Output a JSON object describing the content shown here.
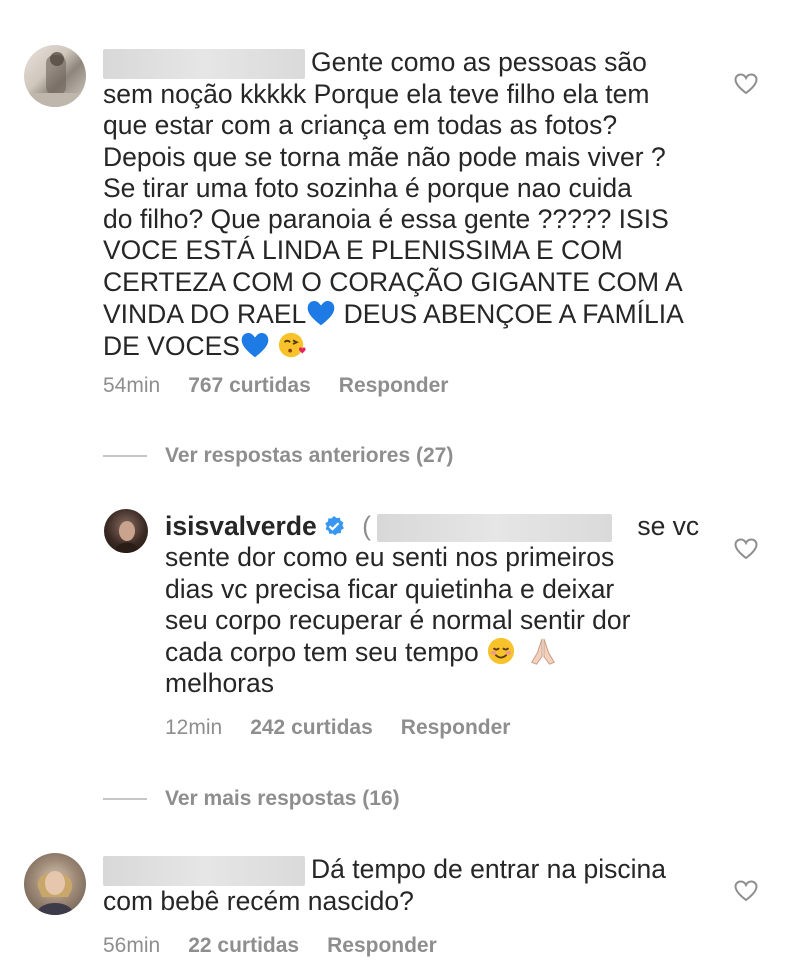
{
  "comments": [
    {
      "text": "Gente como as pessoas são sem noção kkkkk Porque ela teve filho ela tem que estar com a criança em todas as fotos? Depois que se torna mãe não pode mais viver ? Se tirar uma foto sozinha é porque nao cuida do filho? Que paranoia é essa gente ????? ISIS VOCE ESTÁ LINDA E PLENISSIMA E COM CERTEZA COM O CORAÇÃO GIGANTE COM A VINDA DO RAEL",
      "text_line1": "Gente como as pessoas são",
      "lines": [
        "sem noção kkkkk Porque ela teve filho ela tem",
        "que estar com a criança em todas as fotos?",
        "Depois que se torna mãe não pode mais viver ?",
        "Se tirar uma foto sozinha é porque nao cuida",
        "do filho? Que paranoia é essa gente ????? ISIS",
        "VOCE ESTÁ LINDA E PLENISSIMA E COM",
        "CERTEZA COM O CORAÇÃO GIGANTE COM A"
      ],
      "line_rael": "VINDA DO RAEL",
      "line_rael_after": " DEUS ABENÇOE A FAMÍLIA",
      "line_last": "DE VOCES",
      "time": "54min",
      "likes": "767 curtidas",
      "reply": "Responder"
    },
    {
      "username": "isisvalverde",
      "after_mention": " se vc",
      "lines": [
        "sente dor como eu senti nos primeiros",
        "dias vc precisa ficar quietinha e deixar",
        "seu corpo recuperar é normal sentir dor"
      ],
      "line_emoji": "cada corpo tem seu tempo ",
      "line_last": "melhoras",
      "time": "12min",
      "likes": "242 curtidas",
      "reply": "Responder"
    },
    {
      "text_line1": "Dá tempo de entrar na piscina",
      "line2": "com bebê recém nascido?",
      "time": "56min",
      "likes": "22 curtidas",
      "reply": "Responder"
    }
  ],
  "threads": {
    "previous": "Ver respostas anteriores (27)",
    "more": "Ver mais respostas (16)"
  },
  "colors": {
    "text": "#262626",
    "meta": "#8e8e8e",
    "verified": "#3897f0",
    "heart_blue": "#1e7be6"
  }
}
